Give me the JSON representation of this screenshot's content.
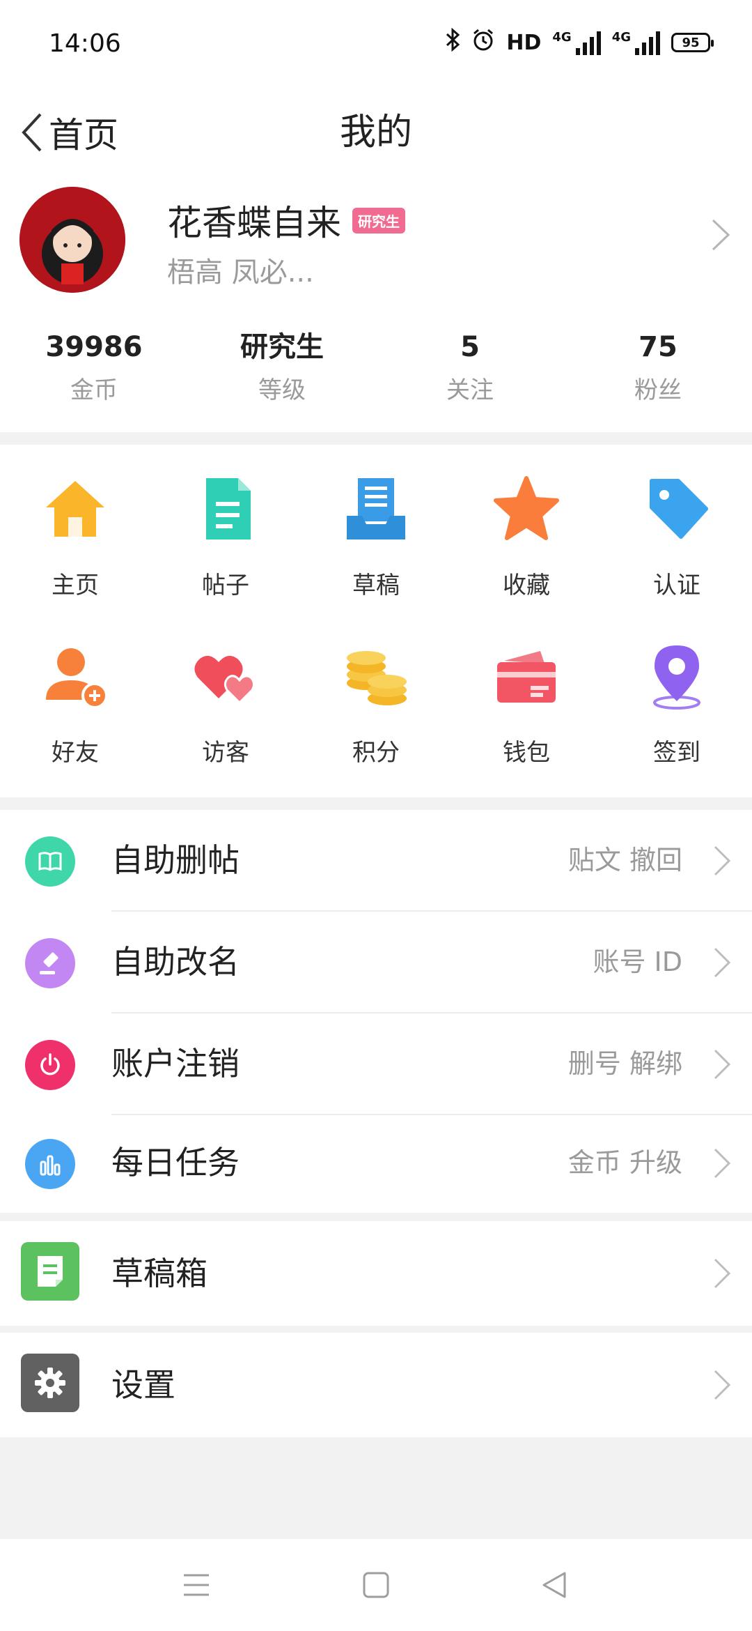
{
  "status_bar": {
    "time": "14:06",
    "hd": "HD",
    "net1": "4G",
    "net2": "4G",
    "battery": "95"
  },
  "nav": {
    "back_label": "首页",
    "title": "我的"
  },
  "profile": {
    "username": "花香蝶自来",
    "badge": "研究生",
    "signature": "梧高  凤必...",
    "stats": [
      {
        "value": "39986",
        "label": "金币"
      },
      {
        "value": "研究生",
        "label": "等级"
      },
      {
        "value": "5",
        "label": "关注"
      },
      {
        "value": "75",
        "label": "粉丝"
      }
    ]
  },
  "grid": [
    {
      "label": "主页",
      "icon": "home-icon"
    },
    {
      "label": "帖子",
      "icon": "document-icon"
    },
    {
      "label": "草稿",
      "icon": "draft-tray-icon"
    },
    {
      "label": "收藏",
      "icon": "star-icon"
    },
    {
      "label": "认证",
      "icon": "tag-icon"
    },
    {
      "label": "好友",
      "icon": "add-friend-icon"
    },
    {
      "label": "访客",
      "icon": "hearts-icon"
    },
    {
      "label": "积分",
      "icon": "coins-icon"
    },
    {
      "label": "钱包",
      "icon": "wallet-card-icon"
    },
    {
      "label": "签到",
      "icon": "location-pin-icon"
    }
  ],
  "list": [
    {
      "label": "自助删帖",
      "hint": "贴文  撤回",
      "icon": "book-icon",
      "color": "#3fd6a9"
    },
    {
      "label": "自助改名",
      "hint": "账号  ID",
      "icon": "gavel-icon",
      "color": "#c387f4"
    },
    {
      "label": "账户注销",
      "hint": "删号  解绑",
      "icon": "power-icon",
      "color": "#f0306a"
    },
    {
      "label": "每日任务",
      "hint": "金币  升级",
      "icon": "bar-chart-icon",
      "color": "#4aa6f2"
    }
  ],
  "drafts": {
    "label": "草稿箱",
    "icon": "draft-box-icon",
    "color": "#5cc25f"
  },
  "settings": {
    "label": "设置",
    "icon": "gear-icon",
    "color": "#616161"
  }
}
